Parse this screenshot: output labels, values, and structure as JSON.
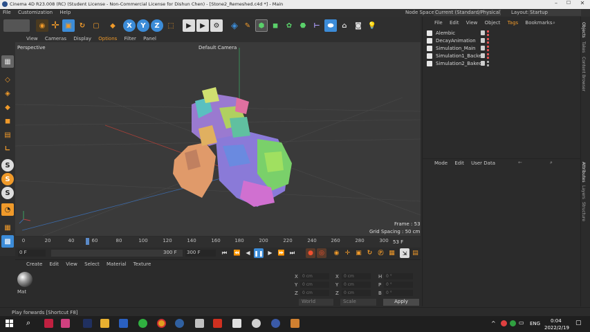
{
  "window": {
    "title": "Cinema 4D R23.008 (RC) (Student License - Non-Commercial License for Dishun Chen) - [Stone2_Remeshed.c4d *] - Main"
  },
  "main_menu": [
    "File",
    "Customization",
    "Help"
  ],
  "node_space": {
    "label": "Node Space:",
    "value": "Current (Standard/Physical)"
  },
  "layout": {
    "label": "Layout:",
    "value": "Startup"
  },
  "toolbar_xyz": [
    "X",
    "Y",
    "Z"
  ],
  "viewport": {
    "menu": [
      "View",
      "Cameras",
      "Display",
      "Options",
      "Filter",
      "Panel"
    ],
    "perspective_label": "Perspective",
    "camera_label": "Default Camera",
    "frame_label": "Frame : 53",
    "grid_label": "Grid Spacing : 50 cm"
  },
  "timeline": {
    "ticks": [
      "0",
      "20",
      "40",
      "60",
      "80",
      "100",
      "120",
      "140",
      "160",
      "180",
      "200",
      "220",
      "240",
      "260",
      "280",
      "300"
    ],
    "current_frame": "53 F",
    "field_start": "0 F",
    "field_current": "0 F",
    "field_end_a": "300 F",
    "field_end_b": "300 F"
  },
  "material_manager": {
    "menu": [
      "Create",
      "Edit",
      "View",
      "Select",
      "Material",
      "Texture"
    ],
    "materials": [
      {
        "name": "Mat"
      }
    ]
  },
  "coordinates": {
    "rows": [
      {
        "a": "X",
        "a_val": "0 cm",
        "b": "X",
        "b_val": "0 cm",
        "c": "H",
        "c_val": "0 °"
      },
      {
        "a": "Y",
        "a_val": "0 cm",
        "b": "Y",
        "b_val": "0 cm",
        "c": "P",
        "c_val": "0 °"
      },
      {
        "a": "Z",
        "a_val": "0 cm",
        "b": "Z",
        "b_val": "0 cm",
        "c": "B",
        "c_val": "0 °"
      }
    ],
    "mode_world": "World",
    "mode_scale": "Scale",
    "apply_label": "Apply"
  },
  "object_manager": {
    "menu": [
      "File",
      "Edit",
      "View",
      "Object",
      "Tags",
      "Bookmarks"
    ],
    "objects": [
      {
        "name": "Alembic"
      },
      {
        "name": "DecayAnimation"
      },
      {
        "name": "Simulation_Main"
      },
      {
        "name": "Simulation1_Backed"
      },
      {
        "name": "Simulation2_Baked"
      }
    ]
  },
  "attribute_manager": {
    "menu": [
      "Mode",
      "Edit",
      "User Data"
    ]
  },
  "side_tabs": [
    "Objects",
    "Takes",
    "Content Browser",
    "Attributes",
    "Layers",
    "Structure"
  ],
  "status_bar": {
    "text": "Play forwards [Shortcut F8]"
  },
  "taskbar": {
    "lang": "ENG",
    "time": "0:04",
    "date": "2022/2/19"
  },
  "colors": {
    "accent_orange": "#f09a2a",
    "accent_blue": "#3c8cd8",
    "bg_dark": "#2b2b2b",
    "viewport_bg": "#3a3a3a"
  }
}
